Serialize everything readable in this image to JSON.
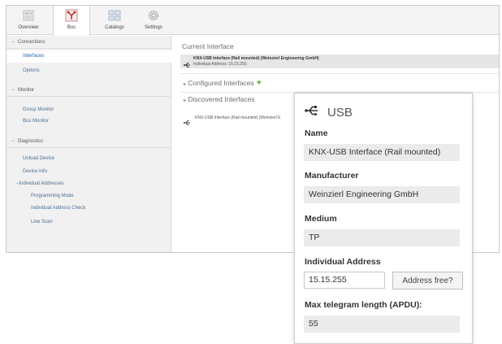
{
  "ribbon": {
    "tabs": [
      {
        "label": "Overview",
        "icon": "overview-icon"
      },
      {
        "label": "Bus",
        "icon": "bus-icon",
        "active": true
      },
      {
        "label": "Catalogs",
        "icon": "catalogs-icon"
      },
      {
        "label": "Settings",
        "icon": "gear-icon"
      }
    ]
  },
  "sidebar": {
    "groups": [
      {
        "header": "Connections",
        "items": [
          "Interfaces",
          "Options"
        ]
      },
      {
        "header": "Monitor",
        "items": [
          "Group Monitor",
          "Bus Monitor"
        ]
      },
      {
        "header": "Diagnostics",
        "items": [
          "Unload Device",
          "Device Info",
          "Individual Addresses",
          "Programming Mode",
          "Individual Address Check",
          "Line Scan"
        ]
      }
    ],
    "selected": "Interfaces"
  },
  "main": {
    "current_title": "Current Interface",
    "current_name": "KNX-USB Interface (Rail mounted) (Weinzierl Engineering GmbH)",
    "current_address": "Individual Address: 15.15.255",
    "configured_title": "Configured Interfaces",
    "configured_add": "+",
    "discovered_title": "Discovered Interfaces",
    "discovered_item": "KNX-USB Interface (Rail mounted) (Weinzierl E"
  },
  "popup": {
    "title": "USB",
    "name_label": "Name",
    "name_value": "KNX-USB Interface (Rail mounted)",
    "manufacturer_label": "Manufacturer",
    "manufacturer_value": "Weinzierl Engineering GmbH",
    "medium_label": "Medium",
    "medium_value": "TP",
    "address_label": "Individual Address",
    "address_value": "15.15.255",
    "address_button": "Address free?",
    "apdu_label": "Max telegram length (APDU):",
    "apdu_value": "55"
  },
  "colors": {
    "accent_green": "#4caa2e",
    "link_blue": "#1f5fa8",
    "sidebar_bg": "#f1f1f1"
  }
}
